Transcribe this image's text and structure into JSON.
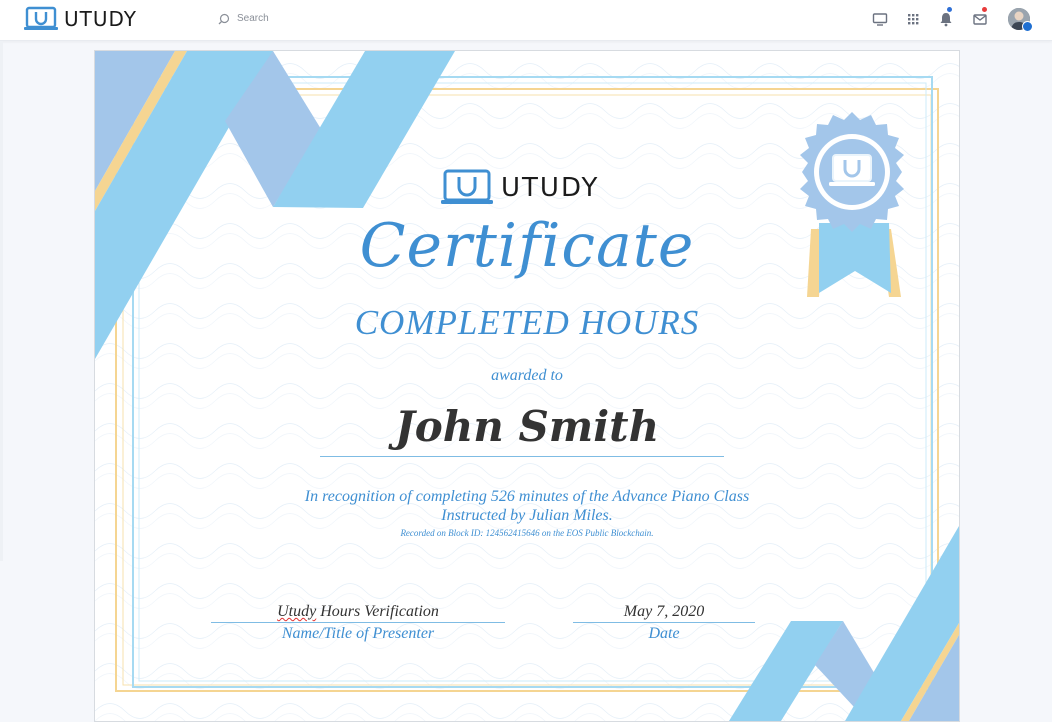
{
  "app": {
    "brand": "UTUDY"
  },
  "header": {
    "search": {
      "placeholder": "Search"
    },
    "icons": [
      "monitor-icon",
      "apps-grid-icon",
      "bell-icon",
      "mail-icon"
    ],
    "notification_dots": {
      "bell": "#2f6fd6",
      "mail": "#e83b3b"
    }
  },
  "certificate": {
    "brand": "UTUDY",
    "title": "Certificate",
    "subtitle": "COMPLETED HOURS",
    "awarded_to": "awarded to",
    "recipient": "John Smith",
    "recognition": "In recognition of completing 526 minutes of the Advance Piano Class",
    "instructed": "Instructed by Julian Miles.",
    "block_record": "Recorded on Block ID: 124562415646 on the EOS Public Blockchain.",
    "presenter": {
      "value_first": "Utudy",
      "value_rest": " Hours Verification",
      "caption": "Name/Title of Presenter"
    },
    "date": {
      "value": "May 7, 2020",
      "caption": "Date"
    },
    "colors": {
      "accent_blue": "#3f8fd2",
      "ribbon_light": "#92d0f0",
      "ribbon_mid": "#a3c6ea",
      "gold": "#f5d592"
    }
  }
}
